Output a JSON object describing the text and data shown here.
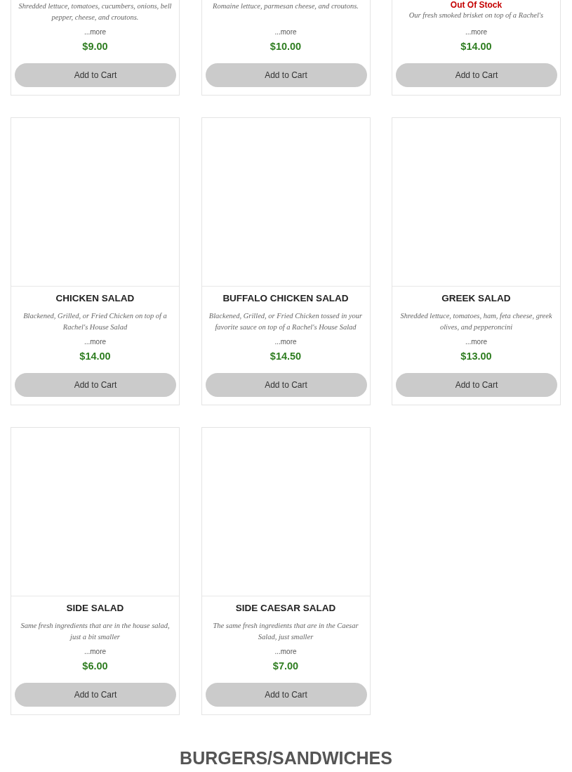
{
  "menu_items": [
    {
      "kind": "cut",
      "description": "Shredded lettuce, tomatoes, cucumbers, onions, bell pepper, cheese, and croutons.",
      "more": "...more",
      "price": "$9.00",
      "button": "Add to Cart"
    },
    {
      "kind": "cut",
      "description": "Romaine lettuce, parmesan cheese, and croutons.",
      "more": "...more",
      "price": "$10.00",
      "button": "Add to Cart"
    },
    {
      "kind": "cut",
      "stock": "Out Of Stock",
      "description": "Our fresh smoked brisket on top of a Rachel's",
      "more": "...more",
      "price": "$14.00",
      "button": "Add to Cart"
    },
    {
      "kind": "full",
      "name": "CHICKEN SALAD",
      "description": "Blackened, Grilled, or Fried Chicken on top of a Rachel's House Salad",
      "more": "...more",
      "price": "$14.00",
      "button": "Add to Cart"
    },
    {
      "kind": "full",
      "name": "BUFFALO CHICKEN SALAD",
      "description": "Blackened, Grilled, or Fried Chicken tossed in your favorite sauce on top of a Rachel's House Salad",
      "more": "...more",
      "price": "$14.50",
      "button": "Add to Cart"
    },
    {
      "kind": "full",
      "name": "GREEK SALAD",
      "description": "Shredded lettuce, tomatoes, ham, feta cheese, greek olives, and pepperoncini",
      "more": "...more",
      "price": "$13.00",
      "button": "Add to Cart"
    },
    {
      "kind": "full",
      "name": "SIDE SALAD",
      "description": "Same fresh ingredients that are in the house salad, just a bit smaller",
      "more": "...more",
      "price": "$6.00",
      "button": "Add to Cart"
    },
    {
      "kind": "full",
      "name": "SIDE CAESAR SALAD",
      "description": "The same fresh ingredients that are in the Caesar Salad, just smaller",
      "more": "...more",
      "price": "$7.00",
      "button": "Add to Cart"
    }
  ],
  "next_section": {
    "title": "BURGERS/SANDWICHES"
  }
}
